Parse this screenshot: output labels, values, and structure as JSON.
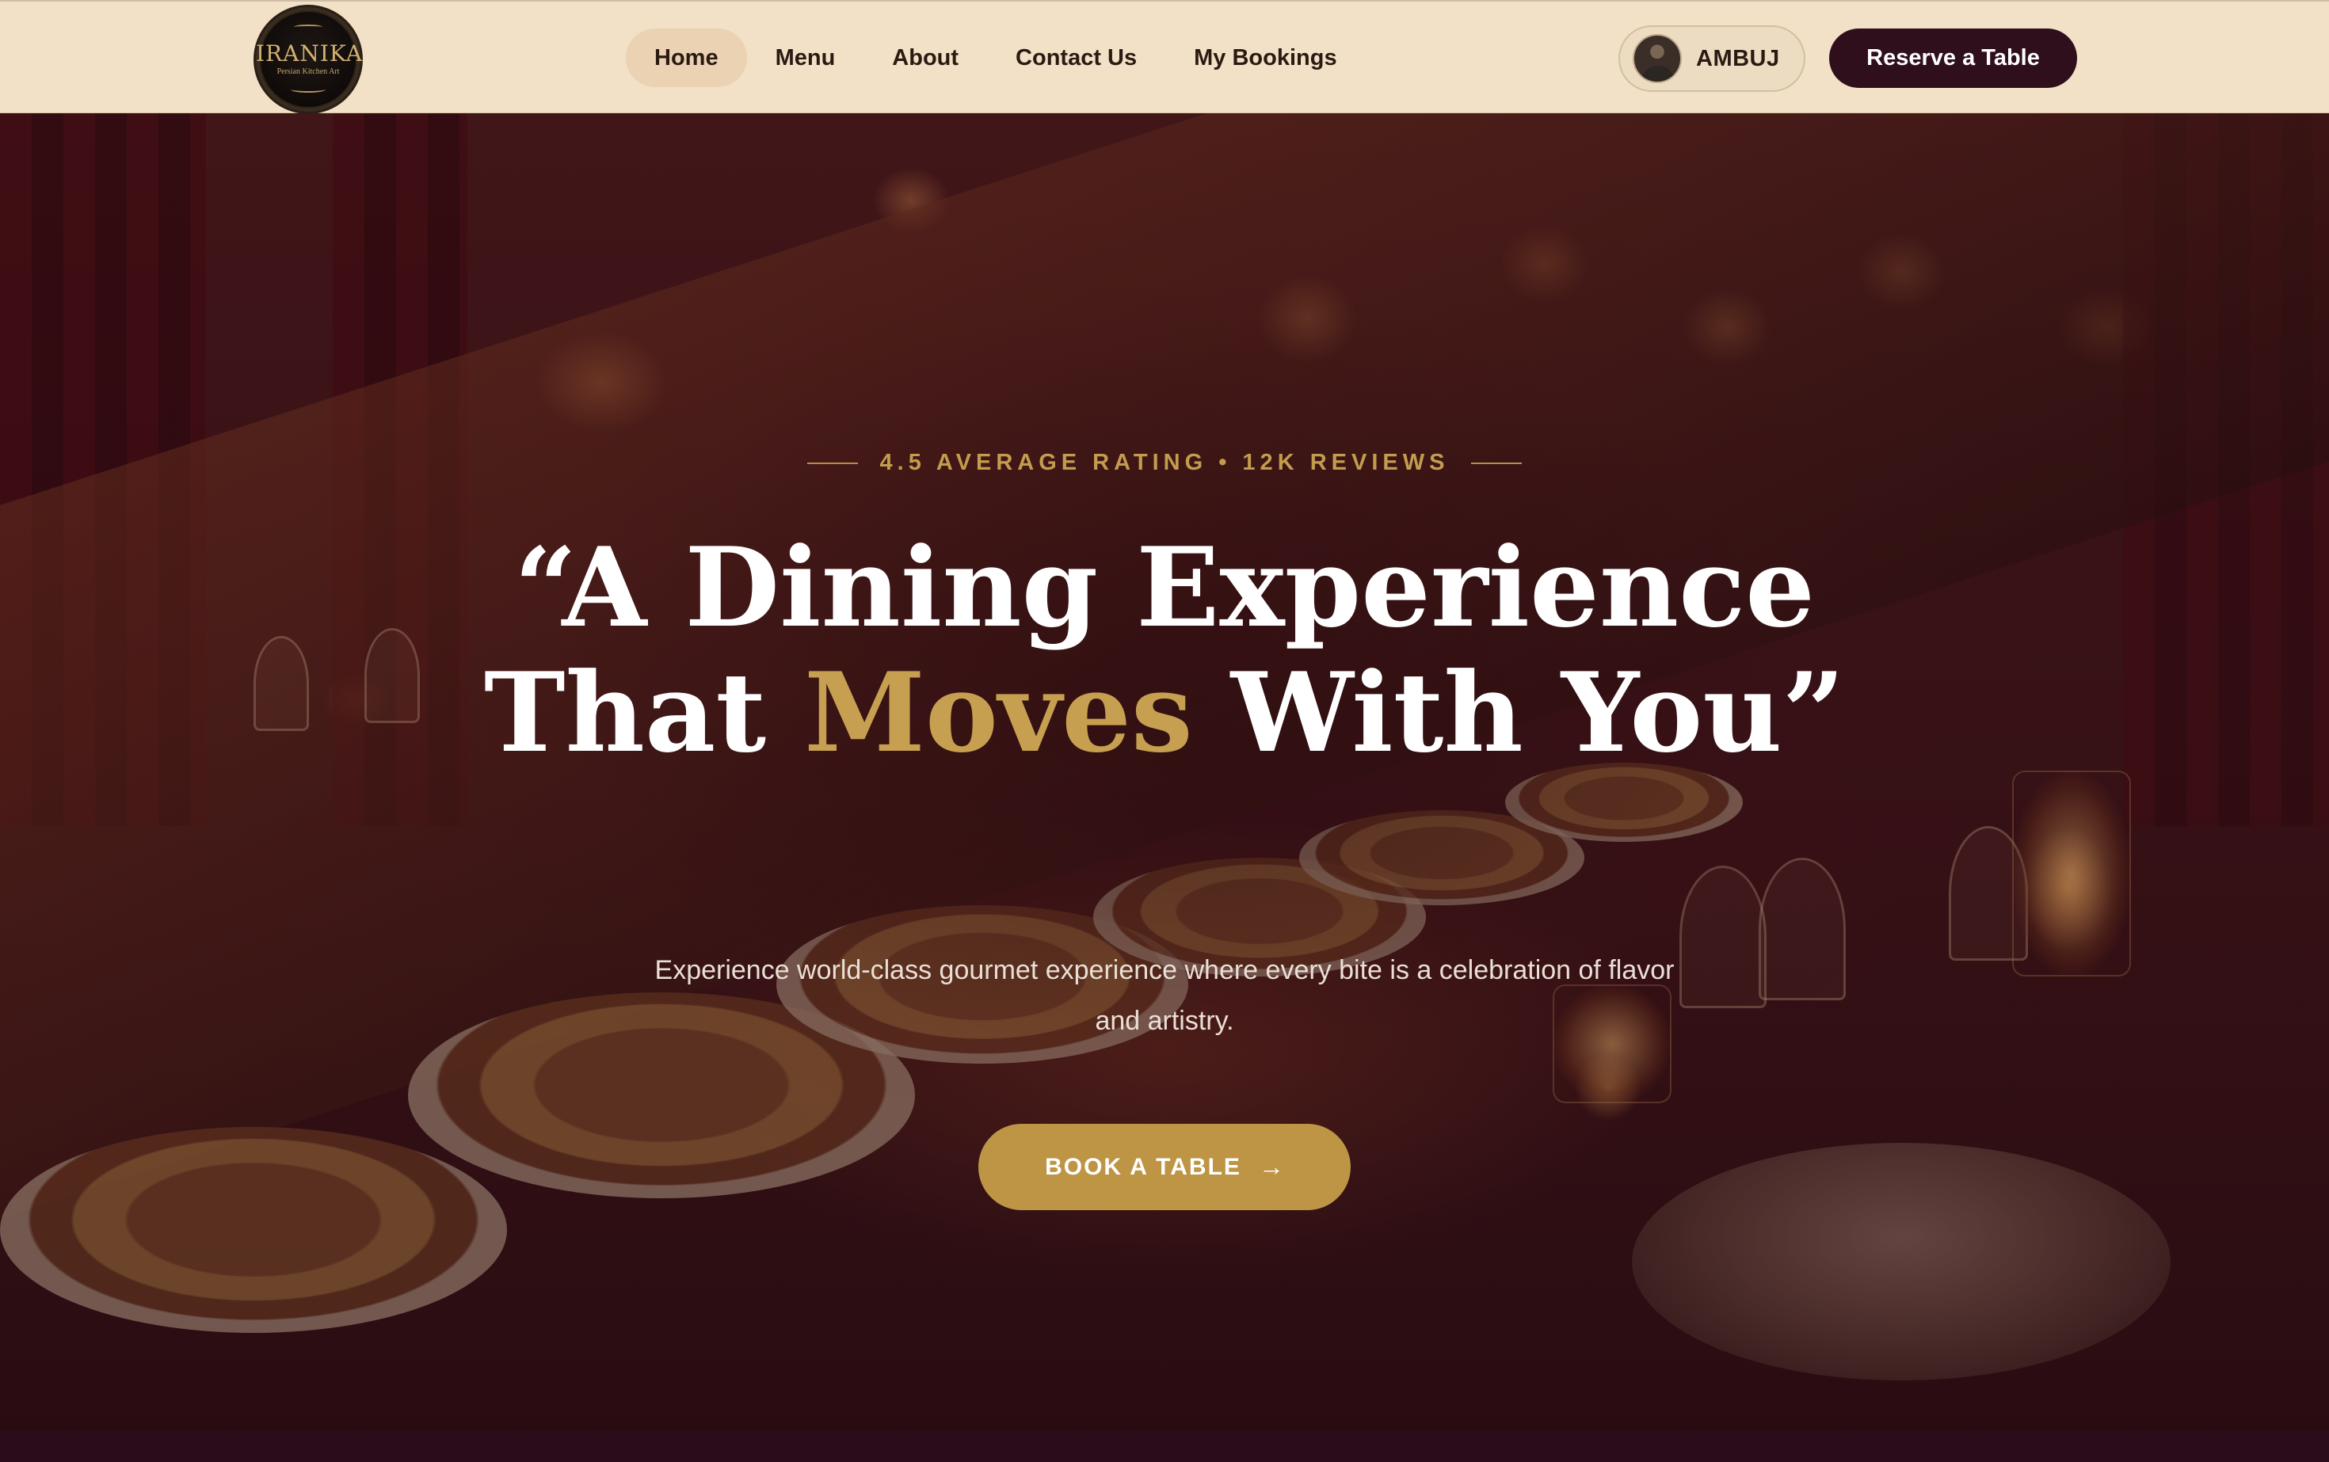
{
  "brand": {
    "logo_text": "IRANIKA",
    "logo_subtitle": "Persian Kitchen Art"
  },
  "nav": {
    "items": [
      {
        "label": "Home",
        "active": true
      },
      {
        "label": "Menu",
        "active": false
      },
      {
        "label": "About",
        "active": false
      },
      {
        "label": "Contact Us",
        "active": false
      },
      {
        "label": "My Bookings",
        "active": false
      }
    ]
  },
  "user": {
    "name": "AMBUJ",
    "avatar_icon": "user-avatar"
  },
  "header_cta": {
    "label": "Reserve a Table"
  },
  "hero": {
    "rating_text": "4.5 AVERAGE RATING • 12K REVIEWS",
    "headline_line1": "“A Dining Experience",
    "headline_line2_prefix": "That ",
    "headline_line2_highlight": "Moves",
    "headline_line2_suffix": " With You”",
    "subtext": "Experience world-class gourmet experience where every bite is a celebration of flavor and artistry.",
    "cta_label": "BOOK A TABLE",
    "cta_icon": "arrow-right-icon"
  },
  "colors": {
    "nav_bg": "#f2e1c6",
    "active_pill": "#ead2b3",
    "primary_dark": "#2f0f1c",
    "gold": "#bd9545",
    "gold_text": "#c6a050",
    "hero_bg": "#3a1418"
  }
}
